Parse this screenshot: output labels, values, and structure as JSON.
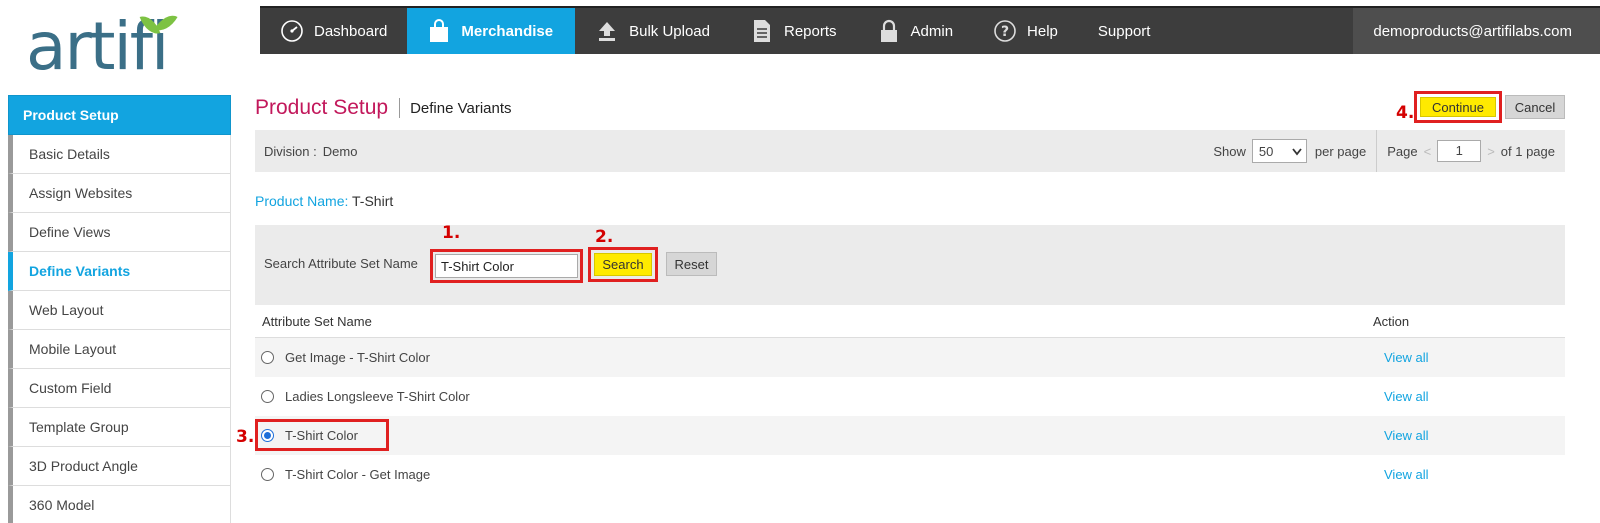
{
  "logo": {
    "text": "artifi"
  },
  "topnav": {
    "items": [
      {
        "label": "Dashboard",
        "icon": "dashboard-gauge-icon"
      },
      {
        "label": "Merchandise",
        "icon": "shopping-bag-icon",
        "active": true
      },
      {
        "label": "Bulk Upload",
        "icon": "upload-icon"
      },
      {
        "label": "Reports",
        "icon": "document-icon"
      },
      {
        "label": "Admin",
        "icon": "lock-icon"
      },
      {
        "label": "Help",
        "icon": "help-circle-icon"
      },
      {
        "label": "Support",
        "icon": ""
      }
    ],
    "user": "demoproducts@artifilabs.com"
  },
  "sidebar": {
    "header": "Product Setup",
    "items": [
      {
        "label": "Basic Details"
      },
      {
        "label": "Assign Websites"
      },
      {
        "label": "Define Views"
      },
      {
        "label": "Define Variants",
        "active": true
      },
      {
        "label": "Web Layout"
      },
      {
        "label": "Mobile Layout"
      },
      {
        "label": "Custom Field"
      },
      {
        "label": "Template Group"
      },
      {
        "label": "3D Product Angle"
      },
      {
        "label": "360 Model"
      }
    ]
  },
  "header": {
    "title": "Product Setup",
    "subtitle": "Define Variants",
    "continue_label": "Continue",
    "cancel_label": "Cancel"
  },
  "division": {
    "label": "Division :",
    "value": "Demo",
    "show_label": "Show",
    "per_page_value": "50",
    "per_page_suffix": "per page",
    "page_label": "Page",
    "page_value": "1",
    "page_total": "of 1 page"
  },
  "product": {
    "label": "Product Name:",
    "value": "T-Shirt"
  },
  "search": {
    "label": "Search Attribute Set Name",
    "value": "T-Shirt Color",
    "search_label": "Search",
    "reset_label": "Reset"
  },
  "table": {
    "headers": {
      "name": "Attribute Set Name",
      "action": "Action"
    },
    "rows": [
      {
        "name": "Get Image - T-Shirt Color",
        "action": "View all",
        "selected": false
      },
      {
        "name": "Ladies Longsleeve T-Shirt Color",
        "action": "View all",
        "selected": false
      },
      {
        "name": "T-Shirt Color",
        "action": "View all",
        "selected": true
      },
      {
        "name": "T-Shirt Color - Get Image",
        "action": "View all",
        "selected": false
      }
    ]
  },
  "steps": {
    "s1": "1.",
    "s2": "2.",
    "s3": "3.",
    "s4": "4."
  },
  "colors": {
    "accent": "#12a4e0",
    "title": "#c2185b",
    "highlight": "#ffea00",
    "annotation": "#e02020"
  }
}
